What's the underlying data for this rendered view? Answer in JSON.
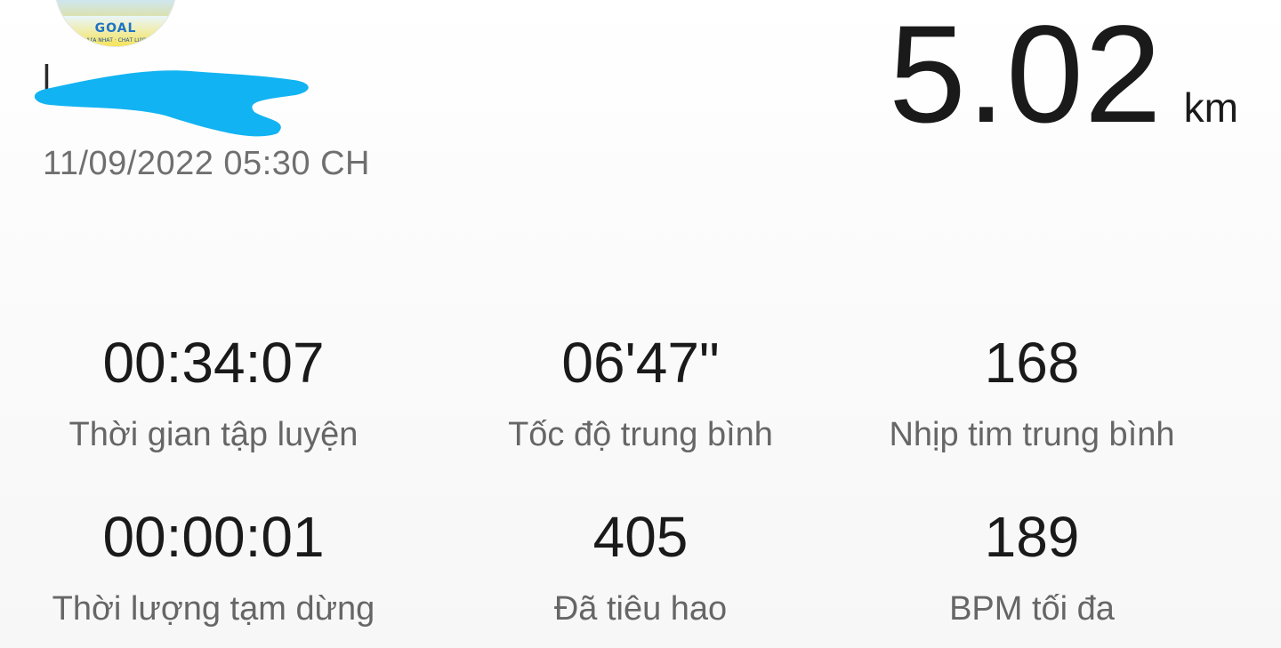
{
  "header": {
    "avatar": {
      "banner_text": "GOAL",
      "banner_subtext": "VỮA NHẤT · CHẤT LƯỢ"
    },
    "username": "l",
    "datetime": "11/09/2022 05:30 CH",
    "redaction_color": "#12b3f2"
  },
  "distance": {
    "value": "5.02",
    "unit": "km"
  },
  "stats": {
    "workout_time": {
      "value": "00:34:07",
      "label": "Thời gian tập luyện"
    },
    "avg_pace": {
      "value": "06'47\"",
      "label": "Tốc độ trung bình"
    },
    "avg_heart_rate": {
      "value": "168",
      "label": "Nhịp tim trung bình"
    },
    "pause_duration": {
      "value": "00:00:01",
      "label": "Thời lượng tạm dừng"
    },
    "calories_burned": {
      "value": "405",
      "label": "Đã tiêu hao"
    },
    "max_bpm": {
      "value": "189",
      "label": "BPM tối đa"
    }
  }
}
